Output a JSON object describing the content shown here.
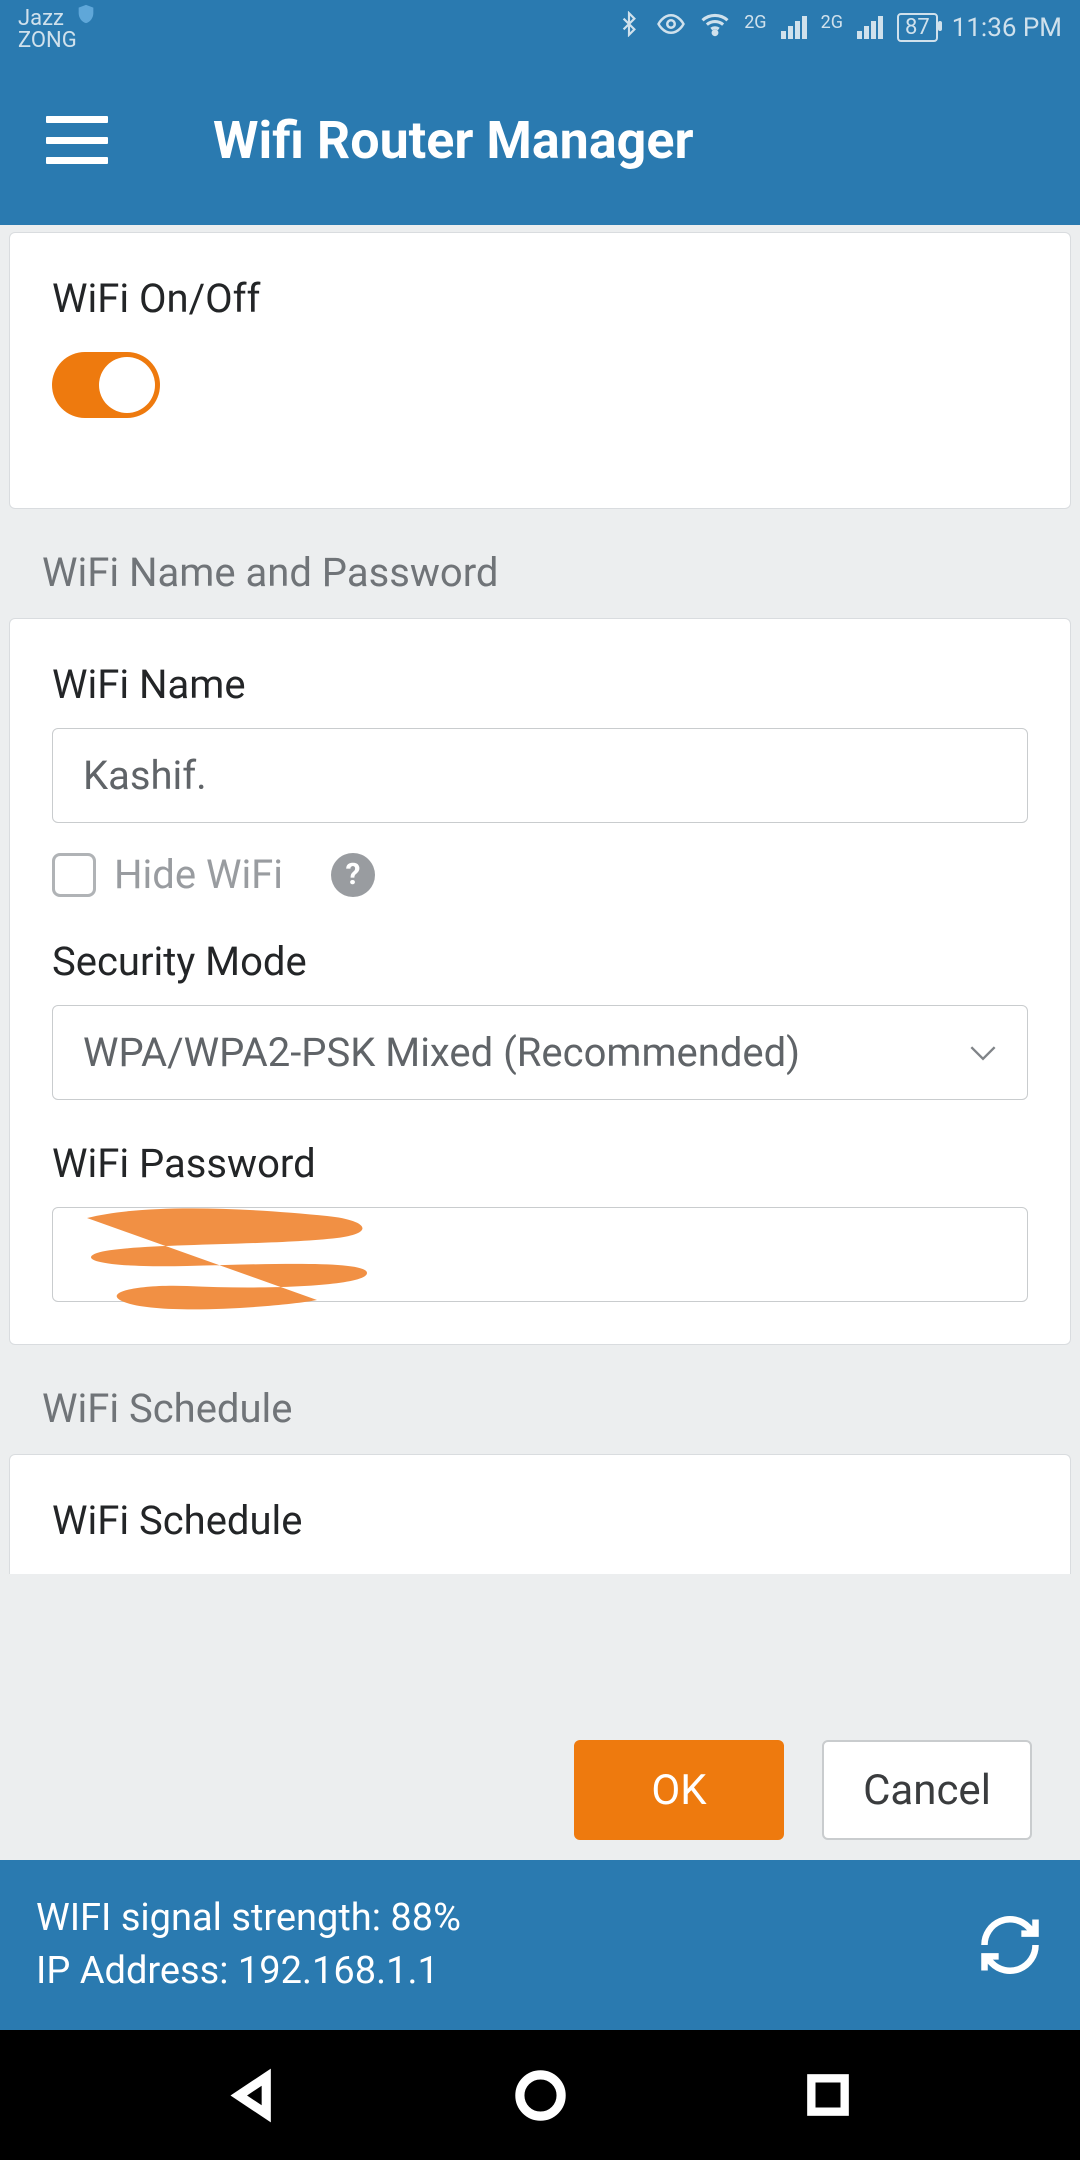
{
  "status": {
    "carrier_line1": "Jazz",
    "carrier_line2": "ZONG",
    "net1": "2G",
    "net2": "2G",
    "battery": "87",
    "time": "11:36 PM"
  },
  "header": {
    "title": "Wifi Router Manager"
  },
  "wifi_toggle": {
    "label": "WiFi On/Off",
    "on": true
  },
  "section_name_pwd": {
    "title": "WiFi Name and Password",
    "wifi_name_label": "WiFi Name",
    "wifi_name_value": "Kashif.",
    "hide_wifi_label": "Hide WiFi",
    "security_mode_label": "Security Mode",
    "security_mode_value": "WPA/WPA2-PSK Mixed (Recommended)",
    "wifi_password_label": "WiFi Password",
    "wifi_password_value": "(redacted)"
  },
  "section_schedule": {
    "title": "WiFi Schedule",
    "row_label": "WiFi Schedule"
  },
  "actions": {
    "ok": "OK",
    "cancel": "Cancel"
  },
  "footer": {
    "line1": "WIFI signal strength: 88%",
    "line2": "IP Address: 192.168.1.1"
  }
}
